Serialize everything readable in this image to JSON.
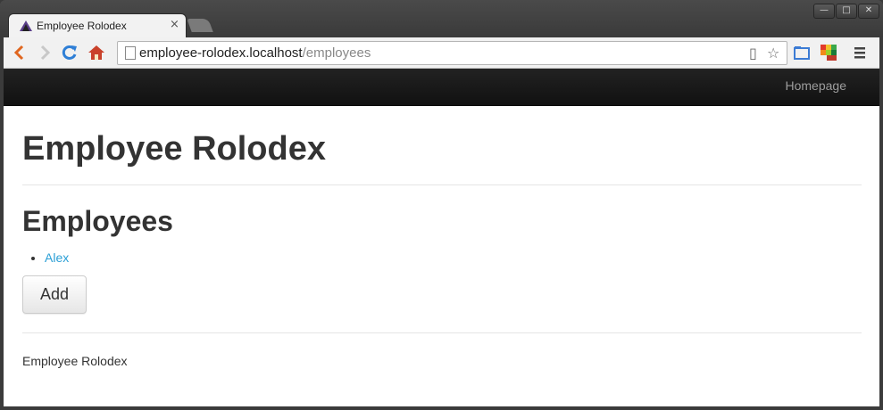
{
  "browser": {
    "tab_title": "Employee Rolodex",
    "tab_close": "×",
    "url_host": "employee-rolodex.localhost",
    "url_path": "/employees",
    "window_buttons": {
      "minimize": "—",
      "maximize": "□",
      "close": "✕"
    },
    "toolbar_icons": [
      "back-icon",
      "forward-icon",
      "reload-icon",
      "home-icon",
      "page-icon",
      "bookmark-star-icon",
      "menu-icon"
    ]
  },
  "navbar": {
    "link": "Homepage"
  },
  "page": {
    "title": "Employee Rolodex",
    "section_heading": "Employees",
    "employees": [
      "Alex"
    ],
    "add_button": "Add",
    "footer_text": "Employee Rolodex"
  },
  "colors": {
    "navbar_bg": "#1a1a1a",
    "link": "#2a9fd6",
    "heading": "#333333"
  }
}
